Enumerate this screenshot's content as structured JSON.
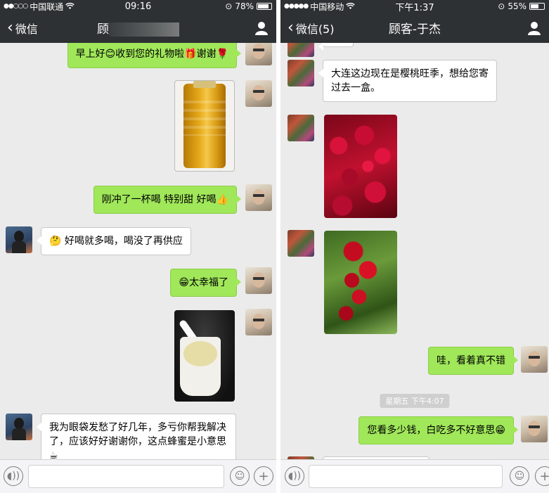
{
  "left_phone": {
    "status": {
      "carrier": "中国联通",
      "time": "09:16",
      "battery": "78%",
      "battery_level": 0.78
    },
    "nav": {
      "back_label": "微信",
      "title_visible_char": "顾"
    },
    "messages": {
      "m1": "早上好😊收到您的礼物啦🎁谢谢🌹",
      "m2": "刚冲了一杯喝 特别甜 好喝👍",
      "m3": "🤔 好喝就多喝，喝没了再供应",
      "m4": "😁太幸福了",
      "m5": "我为眼袋发愁了好几年，多亏你帮我解决了，应该好好谢谢你，这点蜂蜜是小意思☕"
    }
  },
  "right_phone": {
    "status": {
      "carrier": "中国移动",
      "time": "下午1:37",
      "battery": "55%",
      "battery_level": 0.55
    },
    "nav": {
      "back_label": "微信(5)",
      "title": "顾客-于杰"
    },
    "messages": {
      "m1": "大连这边现在是樱桃旺季，想给您寄过去一盒。",
      "m2": "哇，看着真不错",
      "m3": "您看多少钱，白吃多不好意思😁"
    },
    "timestamp": "星期五 下午4:07"
  },
  "icons": [
    "back-chevron-icon",
    "contact-person-icon",
    "voice-icon",
    "emoji-icon",
    "plus-icon",
    "wifi-icon",
    "battery-icon",
    "signal-dots-icon"
  ],
  "colors": {
    "nav_bg": "#2e3133",
    "bubble_green": "#a0e75a",
    "chat_bg": "#ebebeb"
  }
}
